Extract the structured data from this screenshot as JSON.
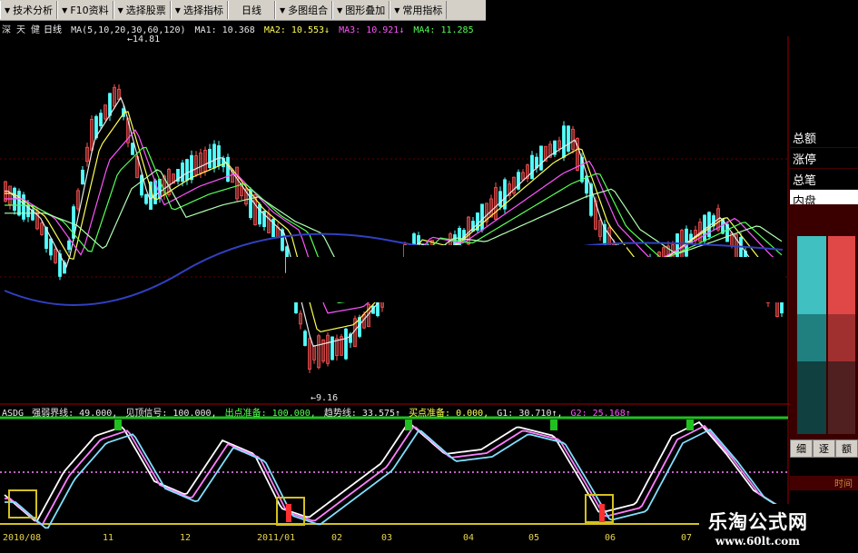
{
  "toolbar": {
    "buttons": [
      {
        "label": "技术分析"
      },
      {
        "label": "F10资料"
      },
      {
        "label": "选择股票"
      },
      {
        "label": "选择指标"
      },
      {
        "label": "日线"
      },
      {
        "label": "多图组合"
      },
      {
        "label": "图形叠加"
      },
      {
        "label": "常用指标"
      }
    ]
  },
  "header": {
    "stock_name": "深 天 健",
    "period": "日线",
    "ma_params": "MA(5,10,20,30,60,120)",
    "ma1": "MA1: 10.368",
    "ma2": "MA2: 10.553↓",
    "ma3": "MA3: 10.921↓",
    "ma4": "MA4: 11.285"
  },
  "price_chart": {
    "high_label": "14.81",
    "low_label": "←9.16"
  },
  "indicator": {
    "name": "ASDG",
    "p1": "强弱界线: 49.000,",
    "p2": "见顶信号: 100.000,",
    "p3": "出点准备: 100.000,",
    "p4": "趋势线: 33.575↑",
    "p5": "买点准备: 0.000,",
    "p6": "G1: 30.710↑,",
    "p7": "G2: 25.168↑"
  },
  "dates": {
    "d1": "2010/08",
    "d2": "11",
    "d3": "12",
    "d4": "2011/01",
    "d5": "02",
    "d6": "03",
    "d7": "04",
    "d8": "05",
    "d9": "06",
    "d10": "07"
  },
  "side_panel": {
    "rows": [
      {
        "label": "总额"
      },
      {
        "label": "涨停"
      },
      {
        "label": "总笔"
      },
      {
        "label": "内盘"
      }
    ],
    "tabs": [
      {
        "label": "细"
      },
      {
        "label": "逐"
      },
      {
        "label": "额"
      }
    ],
    "time_label": "时间"
  },
  "watermark": {
    "title": "乐淘公式网",
    "url": "www.60lt.com"
  },
  "colors": {
    "ma5": "#e8e8e8",
    "ma10": "#ffff54",
    "ma20": "#ff54ff",
    "ma30": "#54ff54",
    "ma60": "#b0ffb0",
    "ma120": "#3040c0",
    "up": "#ff5454",
    "down": "#54ffff"
  }
}
